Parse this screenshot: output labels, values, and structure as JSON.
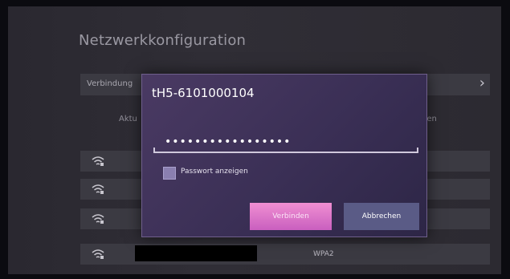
{
  "page": {
    "title": "Netzwerkkonfiguration"
  },
  "list": {
    "connections_label": "Verbindung",
    "header_left": "Aktu",
    "header_right": "gen",
    "networks": [
      {
        "security": ""
      },
      {
        "security": ""
      },
      {
        "security": ""
      },
      {
        "security": "WPA2"
      }
    ]
  },
  "dialog": {
    "network_name": "tH5-6101000104",
    "password_mask": "•••••••••••••••••",
    "show_password_label": "Passwort anzeigen",
    "show_password_checked": false,
    "connect_label": "Verbinden",
    "cancel_label": "Abbrechen"
  },
  "icons": {
    "chevron": "chevron-right-icon",
    "wifi": "wifi-lock-icon"
  },
  "colors": {
    "connect": "#e07ad0",
    "cancel": "#5a5b86",
    "dialog": "#3a2f55"
  }
}
